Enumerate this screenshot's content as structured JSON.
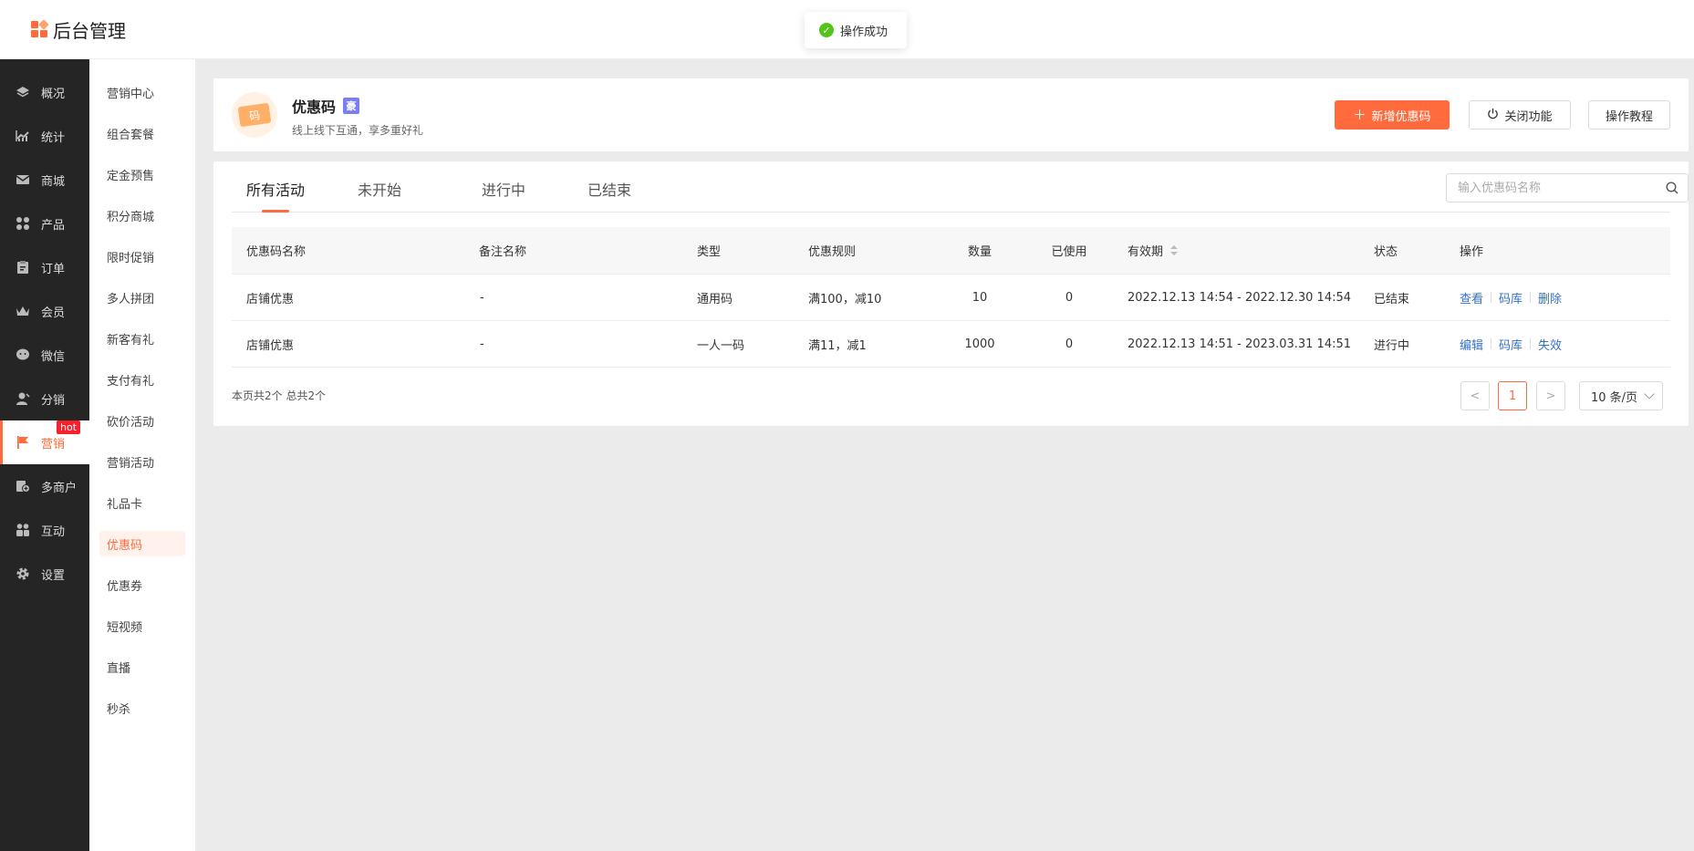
{
  "app": {
    "title": "后台管理"
  },
  "toast": {
    "text": "操作成功"
  },
  "nav": {
    "items": [
      {
        "label": "概况",
        "icon": "layers-icon"
      },
      {
        "label": "统计",
        "icon": "chart-icon"
      },
      {
        "label": "商城",
        "icon": "mail-icon"
      },
      {
        "label": "产品",
        "icon": "grid-icon"
      },
      {
        "label": "订单",
        "icon": "clipboard-icon"
      },
      {
        "label": "会员",
        "icon": "crown-icon"
      },
      {
        "label": "微信",
        "icon": "chat-icon"
      },
      {
        "label": "分销",
        "icon": "user-icon"
      },
      {
        "label": "营销",
        "icon": "flag-icon",
        "badge": "hot"
      },
      {
        "label": "多商户",
        "icon": "store-icon"
      },
      {
        "label": "互动",
        "icon": "people-icon"
      },
      {
        "label": "设置",
        "icon": "gear-icon"
      }
    ]
  },
  "submenu": {
    "items": [
      "营销中心",
      "组合套餐",
      "定金预售",
      "积分商城",
      "限时促销",
      "多人拼团",
      "新客有礼",
      "支付有礼",
      "砍价活动",
      "营销活动",
      "礼品卡",
      "优惠码",
      "优惠券",
      "短视频",
      "直播",
      "秒杀"
    ]
  },
  "feature": {
    "icon_text": "码",
    "title": "优惠码",
    "badge": "🀄",
    "badge_char": "豪",
    "desc": "线上线下互通，享多重好礼"
  },
  "actions": {
    "add": "新增优惠码",
    "close": "关闭功能",
    "tutorial": "操作教程"
  },
  "tabs": [
    "所有活动",
    "未开始",
    "进行中",
    "已结束"
  ],
  "search": {
    "placeholder": "输入优惠码名称"
  },
  "table": {
    "headers": {
      "name": "优惠码名称",
      "remark": "备注名称",
      "type": "类型",
      "rule": "优惠规则",
      "qty": "数量",
      "used": "已使用",
      "period": "有效期",
      "status": "状态",
      "ops": "操作"
    },
    "rows": [
      {
        "name": "店铺优惠",
        "remark": "-",
        "type": "通用码",
        "rule": "满100，减10",
        "qty": "10",
        "used": "0",
        "period": "2022.12.13 14:54 - 2022.12.30 14:54",
        "status": "已结束",
        "ops": [
          "查看",
          "码库",
          "删除"
        ]
      },
      {
        "name": "店铺优惠",
        "remark": "-",
        "type": "一人一码",
        "rule": "满11，减1",
        "qty": "1000",
        "used": "0",
        "period": "2022.12.13 14:51 - 2023.03.31 14:51",
        "status": "进行中",
        "ops": [
          "编辑",
          "码库",
          "失效"
        ]
      }
    ]
  },
  "pagination": {
    "summary": "本页共2个 总共2个",
    "prev": "<",
    "current": "1",
    "next": ">",
    "page_size": "10 条/页"
  },
  "colors": {
    "accent": "#ff6b3d",
    "link": "#3370cc",
    "sidebar": "#252525"
  }
}
